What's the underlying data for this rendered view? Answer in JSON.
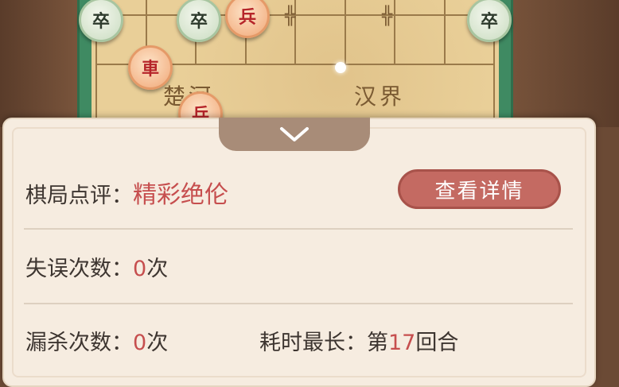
{
  "board": {
    "river_left": "楚河",
    "river_right": "汉界",
    "pieces": [
      {
        "char": "卒",
        "color": "green"
      },
      {
        "char": "卒",
        "color": "green"
      },
      {
        "char": "兵",
        "color": "red"
      },
      {
        "char": "卒",
        "color": "green"
      },
      {
        "char": "車",
        "color": "red"
      },
      {
        "char": "兵",
        "color": "red"
      }
    ]
  },
  "panel": {
    "review_label": "棋局点评：",
    "review_value": "精彩绝伦",
    "detail_button": "查看详情",
    "mistakes_label": "失误次数：",
    "mistakes_count": "0",
    "mistakes_unit": "次",
    "missed_label": "漏杀次数：",
    "missed_count": "0",
    "missed_unit": "次",
    "longest_label": "耗时最长：",
    "longest_prefix": "第",
    "longest_value": "17",
    "longest_suffix": "回合"
  },
  "icons": {
    "collapse": "chevron-down-icon"
  },
  "colors": {
    "accent_red": "#c64e4e",
    "button_bg": "#c46a62",
    "panel_bg": "#f6ece0",
    "board_bg": "#e9cf98",
    "frame_green": "#3f8a62"
  }
}
